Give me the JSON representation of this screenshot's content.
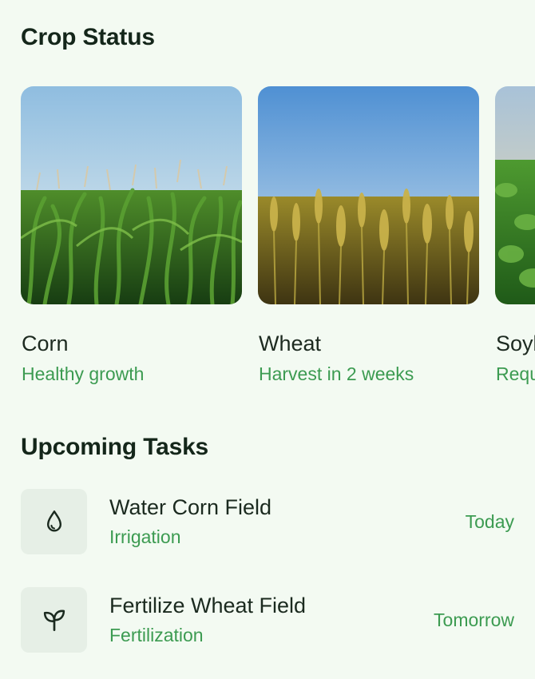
{
  "sections": {
    "crop_status_title": "Crop Status",
    "upcoming_tasks_title": "Upcoming Tasks"
  },
  "crops": [
    {
      "name": "Corn",
      "status": "Healthy growth",
      "image": "corn-field-photo"
    },
    {
      "name": "Wheat",
      "status": "Harvest in 2 weeks",
      "image": "wheat-field-photo"
    },
    {
      "name": "Soybeans",
      "status": "Requires attention",
      "image": "soybean-field-photo"
    }
  ],
  "tasks": [
    {
      "title": "Water Corn Field",
      "category": "Irrigation",
      "due": "Today",
      "icon": "water-drop-icon"
    },
    {
      "title": "Fertilize Wheat Field",
      "category": "Fertilization",
      "due": "Tomorrow",
      "icon": "sprout-icon"
    }
  ],
  "colors": {
    "background": "#f3faf2",
    "accent_green": "#3c9b51",
    "icon_tile": "#e6efe6",
    "heading": "#14261a"
  }
}
